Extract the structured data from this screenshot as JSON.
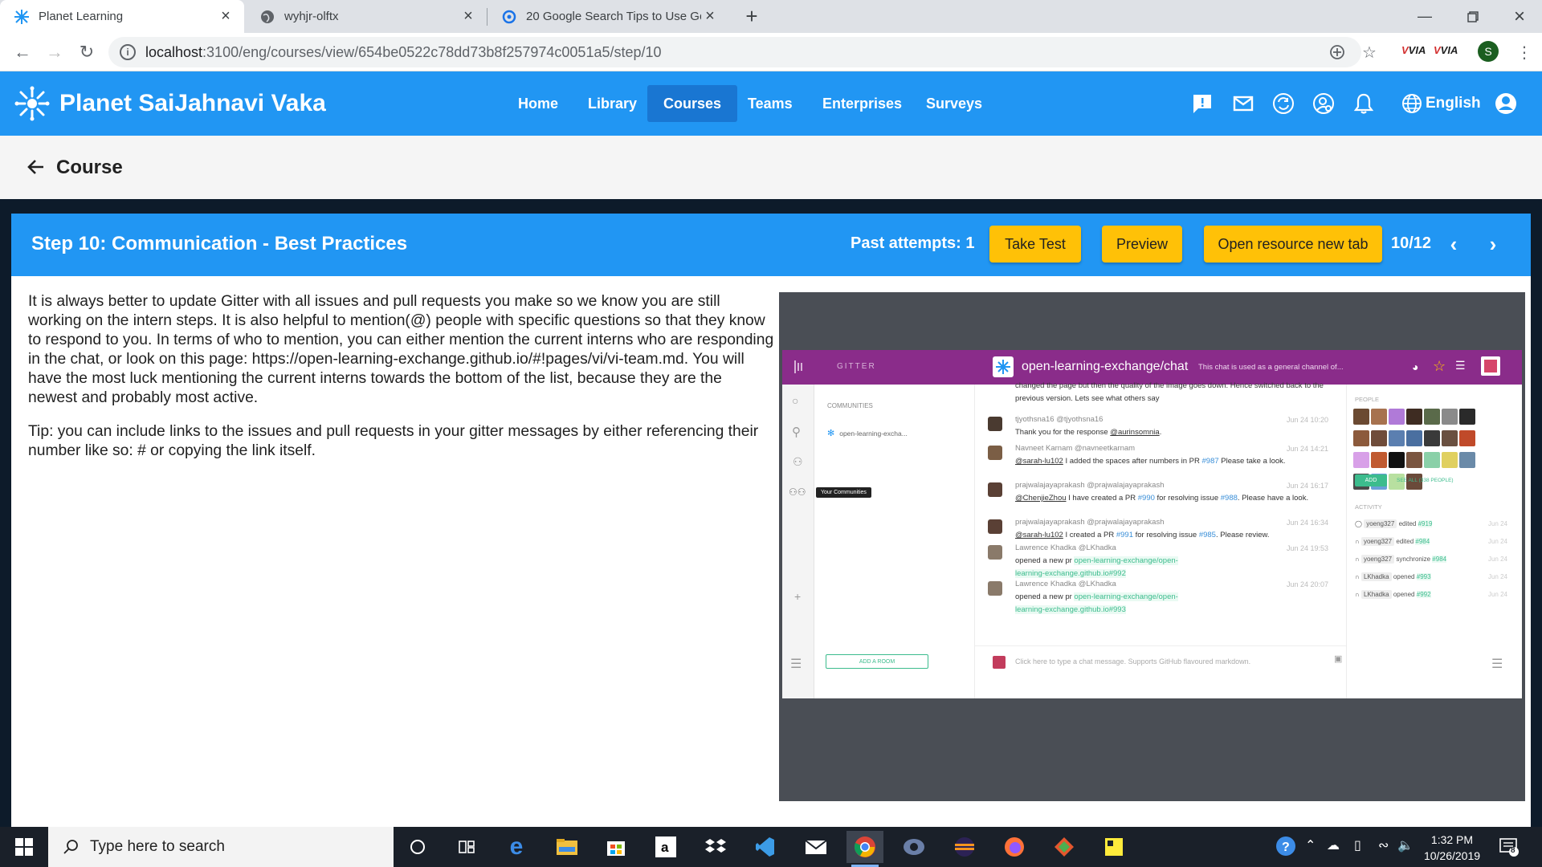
{
  "browser": {
    "tabs": [
      {
        "title": "Planet Learning",
        "active": true
      },
      {
        "title": "wyhjr-olftx",
        "active": false
      },
      {
        "title": "20 Google Search Tips to Use Go",
        "active": false
      }
    ],
    "url_host": "localhost",
    "url_path": ":3100/eng/courses/view/654be0522c78dd73b8f257974c0051a5/step/10",
    "extensions": [
      "VIA",
      "VIA"
    ],
    "profile_initial": "S"
  },
  "app": {
    "brand": "Planet SaiJahnavi Vaka",
    "nav": [
      "Home",
      "Library",
      "Courses",
      "Teams",
      "Enterprises",
      "Surveys"
    ],
    "active_nav": "Courses",
    "language": "English",
    "accent": "#2196f3",
    "accent_dark": "#1976d2"
  },
  "subheader": {
    "title": "Course"
  },
  "step": {
    "title": "Step 10: Communication - Best Practices",
    "attempts": "Past attempts: 1",
    "take_test": "Take Test",
    "preview": "Preview",
    "open_resource": "Open resource new tab",
    "pager": "10/12",
    "button_color": "#ffc107"
  },
  "content": {
    "paragraph1": "It is always better to update Gitter with all issues and pull requests you make so we know you are still working on the intern steps. It is also helpful to mention(@) people with specific questions so that they know to respond to you. In terms of who to mention, you can either mention the current interns who are responding in the chat, or look on this page: https://open-learning-exchange.github.io/#!pages/vi/vi-team.md. You will have the most luck mentioning the current interns towards the bottom of the list, because they are the newest and probably most active.",
    "paragraph2": "Tip: you can include links to the issues and pull requests in your gitter messages by either referencing their number like so: # or copying the link itself."
  },
  "gitter": {
    "brand": "GITTER",
    "room": "open-learning-exchange/chat",
    "topic": "This chat is used as a general channel of...",
    "communities_label": "COMMUNITIES",
    "community_item": "open-learning-excha...",
    "tooltip": "Your Communities",
    "add_room": "ADD A ROOM",
    "input_placeholder": "Click here to type a chat message. Supports GitHub flavoured markdown.",
    "people_label": "PEOPLE",
    "add_label": "ADD",
    "see_all": "SEE ALL (338 PEOPLE)",
    "activity_label": "ACTIVITY",
    "messages": [
      {
        "text_top": "changed the page but then the quality of the image goes down. Hence switched back to the previous version. Lets see what others say"
      },
      {
        "who": "tjyothsna16 @tjyothsna16",
        "time": "Jun 24 10:20",
        "mention": "@aurinsomnia",
        "text": "Thank you for the response "
      },
      {
        "who": "Navneet Karnam @navneetkarnam",
        "time": "Jun 24 14:21",
        "mention": "@sarah-lu102",
        "text": " I added the spaces after numbers in PR ",
        "ref": "#987",
        "tail": " Please take a look."
      },
      {
        "who": "prajwalajayaprakash @prajwalajayaprakash",
        "time": "Jun 24 16:17",
        "mention": "@ChenjieZhou",
        "text": " I have created a PR ",
        "ref": "#990",
        "mid": " for resolving issue ",
        "ref2": "#988",
        "tail": ". Please have a look."
      },
      {
        "who": "prajwalajayaprakash @prajwalajayaprakash",
        "time": "Jun 24 16:34",
        "mention": "@sarah-lu102",
        "text": " I created a PR ",
        "ref": "#991",
        "mid": " for resolving issue ",
        "ref2": "#985",
        "tail": ". Please review."
      },
      {
        "who": "Lawrence Khadka @LKhadka",
        "time": "Jun 24 19:53",
        "text": "opened a new pr ",
        "link": "open-learning-exchange/open-learning-exchange.github.io#992"
      },
      {
        "who": "Lawrence Khadka @LKhadka",
        "time": "Jun 24 20:07",
        "text": "opened a new pr ",
        "link": "open-learning-exchange/open-learning-exchange.github.io#993"
      }
    ],
    "activity": [
      {
        "user": "yoeng327",
        "verb": "edited",
        "ref": "#919",
        "time": "Jun 24"
      },
      {
        "user": "yoeng327",
        "verb": "edited",
        "ref": "#984",
        "time": "Jun 24"
      },
      {
        "user": "yoeng327",
        "verb": "synchronize",
        "ref": "#984",
        "time": "Jun 24"
      },
      {
        "user": "LKhadka",
        "verb": "opened",
        "ref": "#993",
        "time": "Jun 24"
      },
      {
        "user": "LKhadka",
        "verb": "opened",
        "ref": "#992",
        "time": "Jun 24"
      }
    ]
  },
  "taskbar": {
    "search_placeholder": "Type here to search",
    "time": "1:32 PM",
    "date": "10/26/2019",
    "notification_count": "8"
  }
}
